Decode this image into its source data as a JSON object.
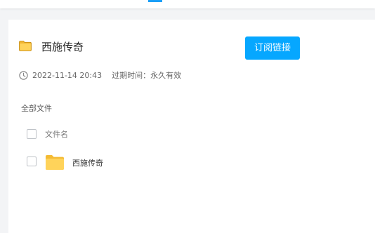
{
  "share": {
    "title": "西施传奇",
    "subscribe_label": "订阅链接",
    "date": "2022-11-14 20:43",
    "expiry_prefix": "过期时间：",
    "expiry_value": "永久有效"
  },
  "breadcrumb": {
    "root": "全部文件"
  },
  "file_list": {
    "header": {
      "name_column": "文件名"
    },
    "rows": [
      {
        "name": "西施传奇",
        "type": "folder",
        "icon": "folder-icon"
      }
    ]
  },
  "colors": {
    "accent": "#06a7ff",
    "folder": "#ffd35a",
    "folder_dark": "#f4bb34"
  }
}
